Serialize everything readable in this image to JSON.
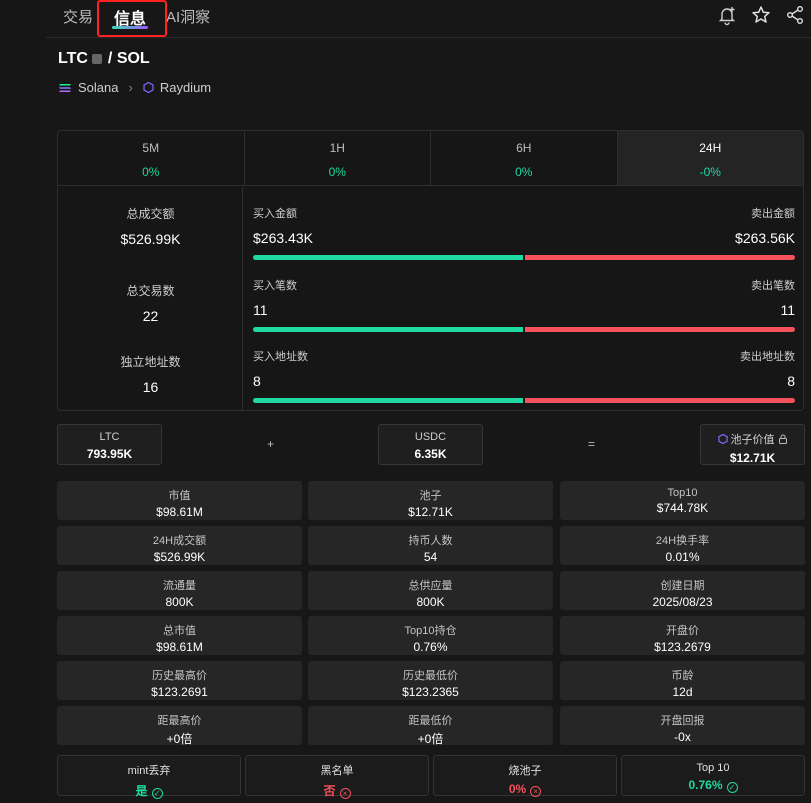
{
  "tabs": [
    {
      "label": "交易"
    },
    {
      "label": "信息"
    },
    {
      "label": "AI洞察"
    }
  ],
  "pair": {
    "base": "LTC",
    "quote": "/ SOL"
  },
  "chain": {
    "network": "Solana",
    "dex": "Raydium"
  },
  "periods": [
    {
      "label": "5M",
      "change": "0%"
    },
    {
      "label": "1H",
      "change": "0%"
    },
    {
      "label": "6H",
      "change": "0%"
    },
    {
      "label": "24H",
      "change": "-0%"
    }
  ],
  "summary": {
    "volume_label": "总成交额",
    "volume": "$526.99K",
    "txns_label": "总交易数",
    "txns": "22",
    "makers_label": "独立地址数",
    "makers": "16"
  },
  "buysell": [
    {
      "buy_label": "买入金额",
      "sell_label": "卖出金额",
      "buy": "$263.43K",
      "sell": "$263.56K",
      "buy_share": 0.4998
    },
    {
      "buy_label": "买入笔数",
      "sell_label": "卖出笔数",
      "buy": "11",
      "sell": "11",
      "buy_share": 0.5
    },
    {
      "buy_label": "买入地址数",
      "sell_label": "卖出地址数",
      "buy": "8",
      "sell": "8",
      "buy_share": 0.5
    }
  ],
  "pool": {
    "token_a_label": "LTC",
    "token_a_value": "793.95K",
    "plus": "+",
    "token_b_label": "USDC",
    "token_b_value": "6.35K",
    "equals": "=",
    "total_label": "池子价值",
    "total_value": "$12.71K"
  },
  "metrics": [
    {
      "label": "市值",
      "value": "$98.61M"
    },
    {
      "label": "池子",
      "value": "$12.71K"
    },
    {
      "label": "Top10",
      "value": "$744.78K"
    },
    {
      "label": "24H成交额",
      "value": "$526.99K"
    },
    {
      "label": "持币人数",
      "value": "54"
    },
    {
      "label": "24H换手率",
      "value": "0.01%"
    },
    {
      "label": "流通量",
      "value": "800K"
    },
    {
      "label": "总供应量",
      "value": "800K"
    },
    {
      "label": "创建日期",
      "value": "2025/08/23"
    },
    {
      "label": "总市值",
      "value": "$98.61M"
    },
    {
      "label": "Top10持仓",
      "value": "0.76%"
    },
    {
      "label": "开盘价",
      "value": "$123.2679"
    },
    {
      "label": "历史最高价",
      "value": "$123.2691"
    },
    {
      "label": "历史最低价",
      "value": "$123.2365"
    },
    {
      "label": "币龄",
      "value": "12d"
    },
    {
      "label": "距最高价",
      "value": "+0倍"
    },
    {
      "label": "距最低价",
      "value": "+0倍"
    },
    {
      "label": "开盘回报",
      "value": "-0x"
    }
  ],
  "security": [
    {
      "label": "mint丢弃",
      "value": "是",
      "status": "ok",
      "mark": "✓"
    },
    {
      "label": "黑名单",
      "value": "否",
      "status": "bad",
      "mark": "×"
    },
    {
      "label": "烧池子",
      "value": "0%",
      "status": "bad",
      "mark": "×"
    },
    {
      "label": "Top 10",
      "value": "0.76%",
      "status": "ok",
      "mark": "✓"
    }
  ],
  "colors": {
    "buy": "#1fd9a0",
    "sell": "#f4525c",
    "highlight": "#ff2020"
  }
}
